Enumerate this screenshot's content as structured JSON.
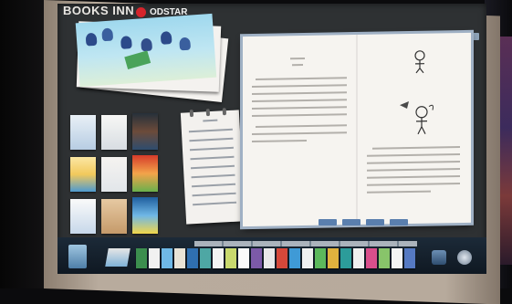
{
  "app": {
    "title": "BOOKS INN",
    "brand": "ODSTAR"
  },
  "colors": {
    "brand_red": "#d5242b",
    "screen_background": "#2e3133",
    "page_controls": "#5a7fae"
  },
  "icons": {
    "brand_logo": "red-circle-logo",
    "shelf_left": "bookshelf-icon",
    "shelf_right_1": "settings-icon",
    "shelf_right_2": "exit-icon"
  }
}
